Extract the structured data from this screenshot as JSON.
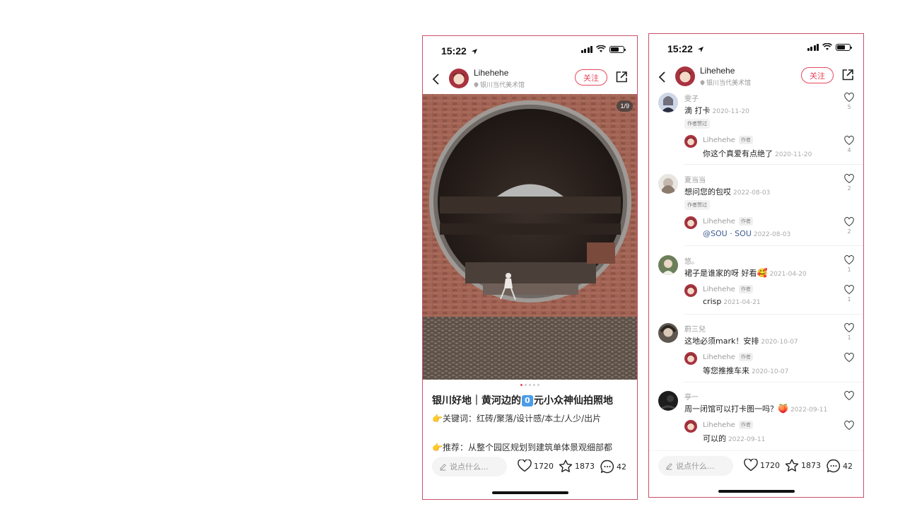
{
  "status": {
    "time": "15:22"
  },
  "header": {
    "username": "Lihehehe",
    "location": "银川当代美术馆",
    "follow_label": "关注"
  },
  "post": {
    "page_indicator": "1/9",
    "title": "银川好地｜黄河边的",
    "title_keycap": "0",
    "title_rest": "元小众神仙拍照地",
    "keywords_line": "关键词：红砖/聚落/设计感/本土/人少/出片",
    "recommend_line": "推荐：从整个园区规划到建筑单体景观细部都",
    "dots": 5,
    "active_dot": 0
  },
  "bottom_bar": {
    "input_placeholder": "说点什么...",
    "likes": "1720",
    "collects": "1873",
    "comments": "42"
  },
  "comments": [
    {
      "name": "雯子",
      "text": "滴 打卡",
      "date": "2020-11-20",
      "likes": "5",
      "author_liked": "作者赞过",
      "reply": {
        "name": "Lihehehe",
        "tag": "作者",
        "text": "你这个真爱有点绝了",
        "date": "2020-11-20",
        "likes": "4"
      }
    },
    {
      "name": "夏当当",
      "text": "想问您的包哎",
      "date": "2022-08-03",
      "likes": "2",
      "author_liked": "作者赞过",
      "reply": {
        "name": "Lihehehe",
        "tag": "作者",
        "mention": "@SOU · SOU",
        "date": "2022-08-03",
        "likes": "2"
      }
    },
    {
      "name": "悠。",
      "text": "裙子是谁家的呀 好看",
      "date": "2021-04-20",
      "likes": "1",
      "reply": {
        "name": "Lihehehe",
        "tag": "作者",
        "text": "crisp",
        "date": "2021-04-21",
        "likes": "1"
      }
    },
    {
      "name": "蔚三兒",
      "text": "这地必须mark！安排",
      "date": "2020-10-07",
      "likes": "1",
      "reply": {
        "name": "Lihehehe",
        "tag": "作者",
        "text": "等您推推车来",
        "date": "2020-10-07",
        "likes": ""
      }
    },
    {
      "name": "亭一",
      "text": "周一闭馆可以打卡图一吗？",
      "date": "2022-09-11",
      "likes": "",
      "reply": {
        "name": "Lihehehe",
        "tag": "作者",
        "text": "可以的",
        "date": "2022-09-11",
        "likes": ""
      }
    }
  ],
  "colors": {
    "accent": "#e8475e",
    "frame": "#c9506a",
    "brick": "#9a5e50"
  },
  "icons": [
    "back-chevron-icon",
    "share-icon",
    "heart-icon",
    "star-icon",
    "comment-icon",
    "pencil-icon",
    "location-pin-icon",
    "signal-icon",
    "wifi-icon",
    "battery-icon",
    "location-arrow-icon"
  ]
}
